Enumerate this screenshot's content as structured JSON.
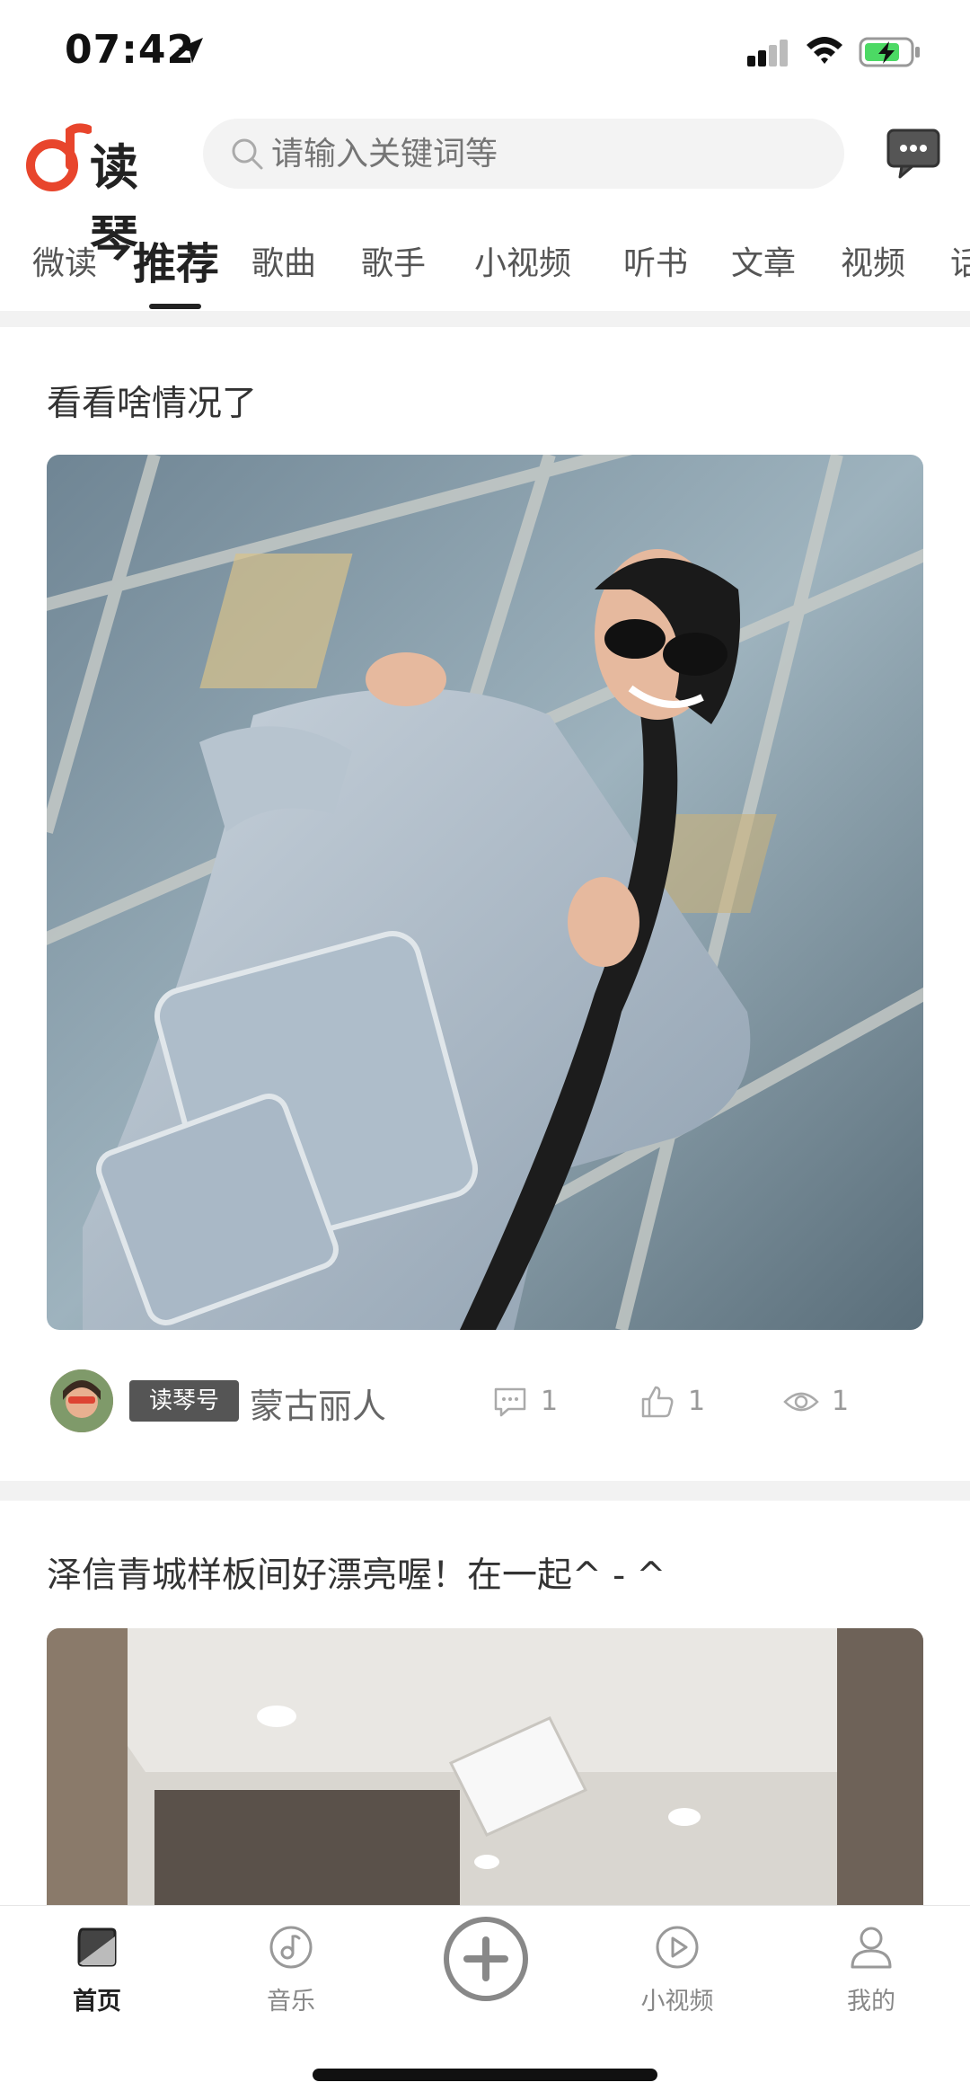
{
  "status_bar": {
    "time": "07:42"
  },
  "header": {
    "app_name": "读琴",
    "search": {
      "placeholder": "请输入关键词等"
    }
  },
  "tabs": [
    {
      "label": "微读",
      "active": false
    },
    {
      "label": "推荐",
      "active": true
    },
    {
      "label": "歌曲",
      "active": false
    },
    {
      "label": "歌手",
      "active": false
    },
    {
      "label": "小视频",
      "active": false
    },
    {
      "label": "听书",
      "active": false
    },
    {
      "label": "文章",
      "active": false
    },
    {
      "label": "视频",
      "active": false
    },
    {
      "label": "话",
      "active": false
    }
  ],
  "feed": [
    {
      "title": "看看啥情况了",
      "badge": "读琴号",
      "author": "蒙古丽人",
      "comments": "1",
      "likes": "1",
      "views": "1"
    },
    {
      "title": "泽信青城样板间好漂亮喔！在一起^ - ^"
    }
  ],
  "bottom_nav": [
    {
      "label": "首页",
      "icon": "home-icon",
      "active": true
    },
    {
      "label": "音乐",
      "icon": "music-icon",
      "active": false
    },
    {
      "label": "",
      "icon": "add-icon",
      "active": false
    },
    {
      "label": "小视频",
      "icon": "play-icon",
      "active": false
    },
    {
      "label": "我的",
      "icon": "profile-icon",
      "active": false
    }
  ],
  "colors": {
    "brand": "#e8452c",
    "text_primary": "#222222",
    "text_muted": "#999999",
    "badge_bg": "#555555"
  }
}
